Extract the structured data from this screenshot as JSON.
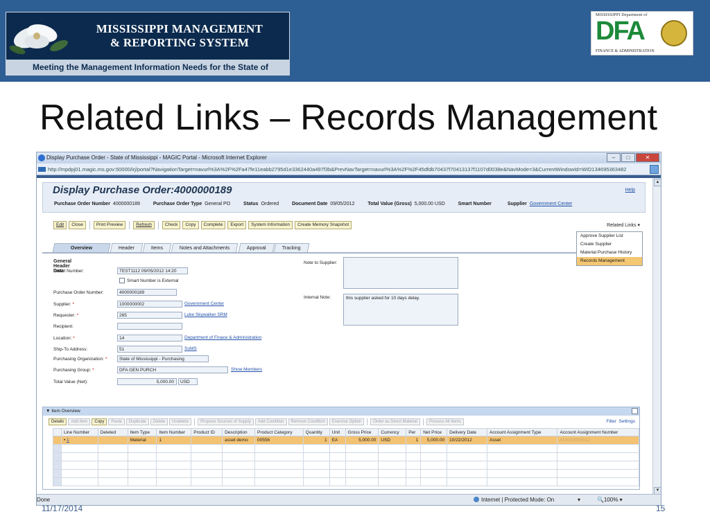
{
  "colors": {
    "banner": "#2e5f94",
    "accent_row": "#f3c272",
    "menu_selected": "#f4c773",
    "link": "#1f4fa8"
  },
  "logos": {
    "mmrs_title_line1": "MISSISSIPPI MANAGEMENT",
    "mmrs_title_line2": "& REPORTING SYSTEM",
    "mmrs_tagline": "Meeting the Management Information Needs for the State of Mississippi",
    "dfa_top": "MISSISSIPPI Department of",
    "dfa_letters": "DFA",
    "dfa_bottom": "FINANCE & ADMINISTRATION"
  },
  "slide": {
    "title": "Related Links – Records Management",
    "date": "11/17/2014",
    "page_number": "15"
  },
  "browser": {
    "title": "Display Purchase Order - State of Mississippi - MAGIC Portal - Microsoft Internet Explorer",
    "address": "http://mpdpj01.magic.ms.gov:50000/irj/portal?NavigationTarget=navurl%3A%2F%2Fa47fe11eabb2795d1e3362440a497f3b&PrevNavTarget=navurl%3A%2F%2F45dfdb70437f70413137f1107d0038e&NavMode=3&CurrentWindowId=WID134695363482",
    "status_left": "Done",
    "status_zone": "Internet | Protected Mode: On",
    "zoom": "100%"
  },
  "document": {
    "title": "Display Purchase Order:4000000189",
    "help": "Help",
    "header_fields": [
      {
        "label": "Purchase Order Number",
        "value": "4000000189"
      },
      {
        "label": "Purchase Order Type",
        "value": "General PO"
      },
      {
        "label": "Status",
        "value": "Ordered"
      },
      {
        "label": "Document Date",
        "value": "09/05/2012"
      },
      {
        "label": "Total Value (Gross)",
        "value": "5,000.00 USD"
      },
      {
        "label": "Smart Number",
        "value": ""
      },
      {
        "label": "Supplier",
        "value": "Government Center"
      }
    ]
  },
  "toolbar": {
    "buttons": [
      "Edit",
      "Close",
      "Print Preview",
      "Refresh",
      "Check",
      "Copy",
      "Complete",
      "Export",
      "System Information",
      "Create Memory Snapshot"
    ],
    "related_links": "Related Links"
  },
  "related_menu": {
    "items": [
      "Approve Supplier List",
      "Create Supplier",
      "Material Purchase History",
      "Records Management"
    ],
    "selected": "Records Management"
  },
  "tabs": [
    "Overview",
    "Header",
    "Items",
    "Notes and Attachments",
    "Approval",
    "Tracking"
  ],
  "form": {
    "section_title": "General Header Data",
    "smart_number_label": "Smart Number:",
    "smart_number_value": "TEST1112 09/05/2012 14:20",
    "smart_external_label": "Smart Number is External",
    "po_number_label": "Purchase Order Number:",
    "po_number_value": "4000000189",
    "supplier_label": "Supplier:",
    "supplier_value": "1000000002",
    "supplier_link": "Government Center",
    "requester_label": "Requester:",
    "requester_value": "265",
    "requester_link": "Luke Skywalker SRM",
    "recipient_label": "Recipient:",
    "recipient_value": "",
    "location_label": "Location:",
    "location_value": "14",
    "location_link": "Department of Finace & Administration",
    "shipto_label": "Ship-To Address:",
    "shipto_value": "51",
    "shipto_link": "SoMS",
    "purch_org_label": "Purchasing Organization:",
    "purch_org_value": "State of Mississippi - Purchasing",
    "purch_group_label": "Purchasing Group:",
    "purch_group_value": "DFA GEN PURCH",
    "purch_group_link": "Show Members",
    "total_label": "Total Value (Net):",
    "total_value": "5,000.00",
    "total_currency": "USD",
    "note_supplier_label": "Note to Supplier:",
    "note_supplier_value": "",
    "internal_note_label": "Internal Note:",
    "internal_note_value": "this supplier asked for 10 days delay."
  },
  "items": {
    "section_title": "Item Overview",
    "buttons": [
      {
        "label": "Details",
        "enabled": true
      },
      {
        "label": "Add Item",
        "enabled": false
      },
      {
        "label": "Copy",
        "enabled": true
      },
      {
        "label": "Paste",
        "enabled": false
      },
      {
        "label": "Duplicate",
        "enabled": false
      },
      {
        "label": "Delete",
        "enabled": false
      },
      {
        "label": "Undelete",
        "enabled": false
      },
      {
        "label": "Propose Sources of Supply",
        "enabled": false
      },
      {
        "label": "Add Condition",
        "enabled": false
      },
      {
        "label": "Remove Condition",
        "enabled": false
      },
      {
        "label": "Exercise Option",
        "enabled": false
      },
      {
        "label": "Order as Direct Material",
        "enabled": false
      },
      {
        "label": "Process All Items",
        "enabled": false
      }
    ],
    "filter": "Filter",
    "settings": "Settings",
    "columns": [
      "Line Number",
      "Deleted",
      "Item Type",
      "Item Number",
      "Product ID",
      "Description",
      "Product Category",
      "Quantity",
      "Unit",
      "Gross Price",
      "Currency",
      "Per",
      "Net Price",
      "Delivery Date",
      "Account Assignment Type",
      "Account Assignment Number"
    ],
    "rows": [
      [
        "1",
        "",
        "Material",
        "1",
        "",
        "asset demo",
        "00556",
        "1",
        "EA",
        "5,000.00",
        "USD",
        "1",
        "5,000.00",
        "10/22/2012",
        "Asset",
        "410000000012"
      ]
    ]
  }
}
